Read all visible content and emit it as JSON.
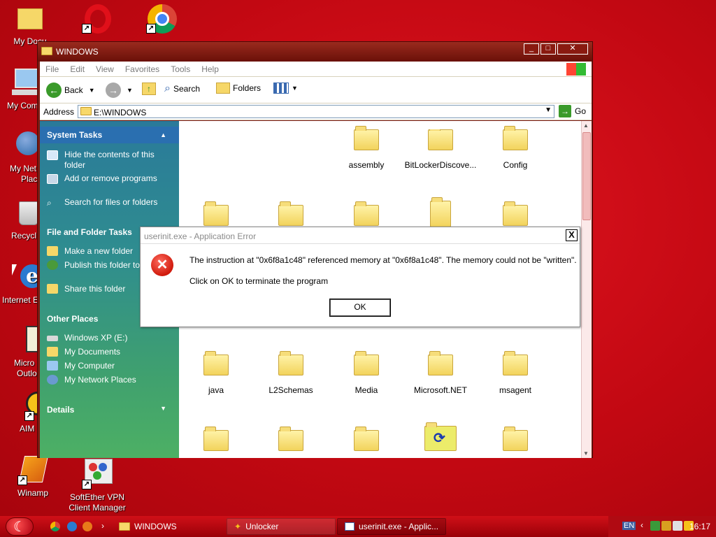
{
  "desktop": {
    "icons": [
      {
        "label": "My Docu",
        "name": "my-documents"
      },
      {
        "label": "My Com",
        "name": "my-computer"
      },
      {
        "label": "My Net",
        "label2": "Plac",
        "name": "my-network-places"
      },
      {
        "label": "Recycl",
        "name": "recycle-bin"
      },
      {
        "label": "Internet E",
        "name": "internet-explorer"
      },
      {
        "label": "Micro",
        "label2": "Outlo",
        "name": "microsoft-outlook"
      },
      {
        "label": "AIM",
        "name": "aim"
      },
      {
        "label": "Winamp",
        "name": "winamp"
      },
      {
        "label": "SoftEther VPN",
        "label2": "Client Manager",
        "name": "softether-vpn"
      },
      {
        "label": "",
        "name": "opera"
      },
      {
        "label": "",
        "name": "google-chrome"
      }
    ]
  },
  "explorer": {
    "title": "WINDOWS",
    "menu": [
      "File",
      "Edit",
      "View",
      "Favorites",
      "Tools",
      "Help"
    ],
    "toolbar": {
      "back": "Back",
      "search": "Search",
      "folders": "Folders"
    },
    "address": {
      "label": "Address",
      "value": "E:\\WINDOWS",
      "go": "Go"
    },
    "taskpane": {
      "system_tasks": {
        "title": "System Tasks",
        "items": [
          "Hide the contents of this folder",
          "Add or remove programs",
          "Search for files or folders"
        ]
      },
      "file_folder_tasks": {
        "title": "File and Folder Tasks",
        "items": [
          "Make a new folder",
          "Publish this folder to Web",
          "Share this folder"
        ]
      },
      "other_places": {
        "title": "Other Places",
        "items": [
          "Windows XP (E:)",
          "My Documents",
          "My Computer",
          "My Network Places"
        ]
      },
      "details": {
        "title": "Details"
      }
    },
    "folders_row1": [
      "assembly",
      "BitLockerDiscove...",
      "Config"
    ],
    "folders_row3": [
      "java",
      "L2Schemas",
      "Media",
      "Microsoft.NET",
      "msagent"
    ]
  },
  "dialog": {
    "title": "userinit.exe - Application Error",
    "message": "The instruction at \"0x6f8a1c48\" referenced memory at \"0x6f8a1c48\". The memory could not be \"written\".",
    "message2": "Click on OK to terminate the program",
    "ok": "OK",
    "close": "X"
  },
  "taskbar": {
    "tasks": [
      "WINDOWS",
      "Unlocker",
      "userinit.exe - Applic..."
    ],
    "lang": "EN",
    "time": "16:17"
  },
  "colors": {
    "desktop": "#c20812",
    "taskpane": "#2f8d8f",
    "titlebar": "#7a1a12"
  }
}
